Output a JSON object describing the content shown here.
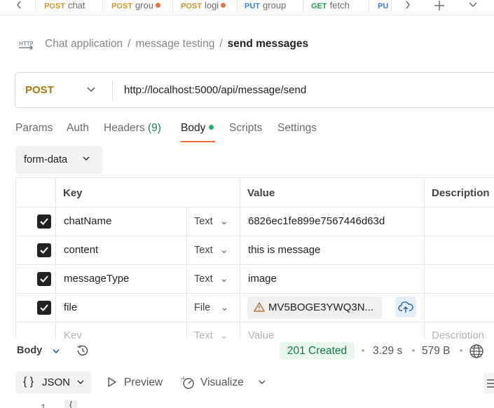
{
  "tabs": [
    {
      "method": "POST",
      "name": "chat",
      "method_color": "#c8962a",
      "unsaved": false
    },
    {
      "method": "POST",
      "name": "grou",
      "method_color": "#c8962a",
      "unsaved": true
    },
    {
      "method": "POST",
      "name": "logi",
      "method_color": "#c8962a",
      "unsaved": true
    },
    {
      "method": "PUT",
      "name": "group",
      "method_color": "#3b7ddd",
      "unsaved": false
    },
    {
      "method": "GET",
      "name": "fetch",
      "method_color": "#1f9d55",
      "unsaved": false
    },
    {
      "method": "PU",
      "name": "",
      "method_color": "#3b7ddd",
      "unsaved": false
    }
  ],
  "breadcrumb": {
    "badge": "HTTP",
    "collection": "Chat application",
    "folder": "message testing",
    "request": "send messages",
    "separator": "/"
  },
  "request": {
    "method": "POST",
    "url": "http://localhost:5000/api/message/send"
  },
  "request_tabs": {
    "params": "Params",
    "auth": "Auth",
    "headers": "Headers",
    "headers_count": "(9)",
    "body": "Body",
    "scripts": "Scripts",
    "settings": "Settings"
  },
  "body_type": "form-data",
  "table": {
    "headers": {
      "key": "Key",
      "value": "Value",
      "description": "Description"
    },
    "rows": [
      {
        "key": "chatName",
        "type": "Text",
        "value": "6826ec1fe899e7567446d63d"
      },
      {
        "key": "content",
        "type": "Text",
        "value": "this is message"
      },
      {
        "key": "messageType",
        "type": "Text",
        "value": "image"
      },
      {
        "key": "file",
        "type": "File",
        "value": "MV5BOGE3YWQ3N..."
      }
    ],
    "placeholder": {
      "key": "Key",
      "type": "Text",
      "value": "Value",
      "description": "Description"
    }
  },
  "response": {
    "label": "Body",
    "status": "201 Created",
    "time": "3.29 s",
    "size": "579 B",
    "format": "JSON",
    "format_icon": "{ }",
    "preview": "Preview",
    "visualize": "Visualize",
    "first_line": "1",
    "first_token": "{"
  },
  "colors": {
    "accent": "#f26b3a",
    "post": "#a97a0f",
    "status_green": "#0f7a45"
  }
}
